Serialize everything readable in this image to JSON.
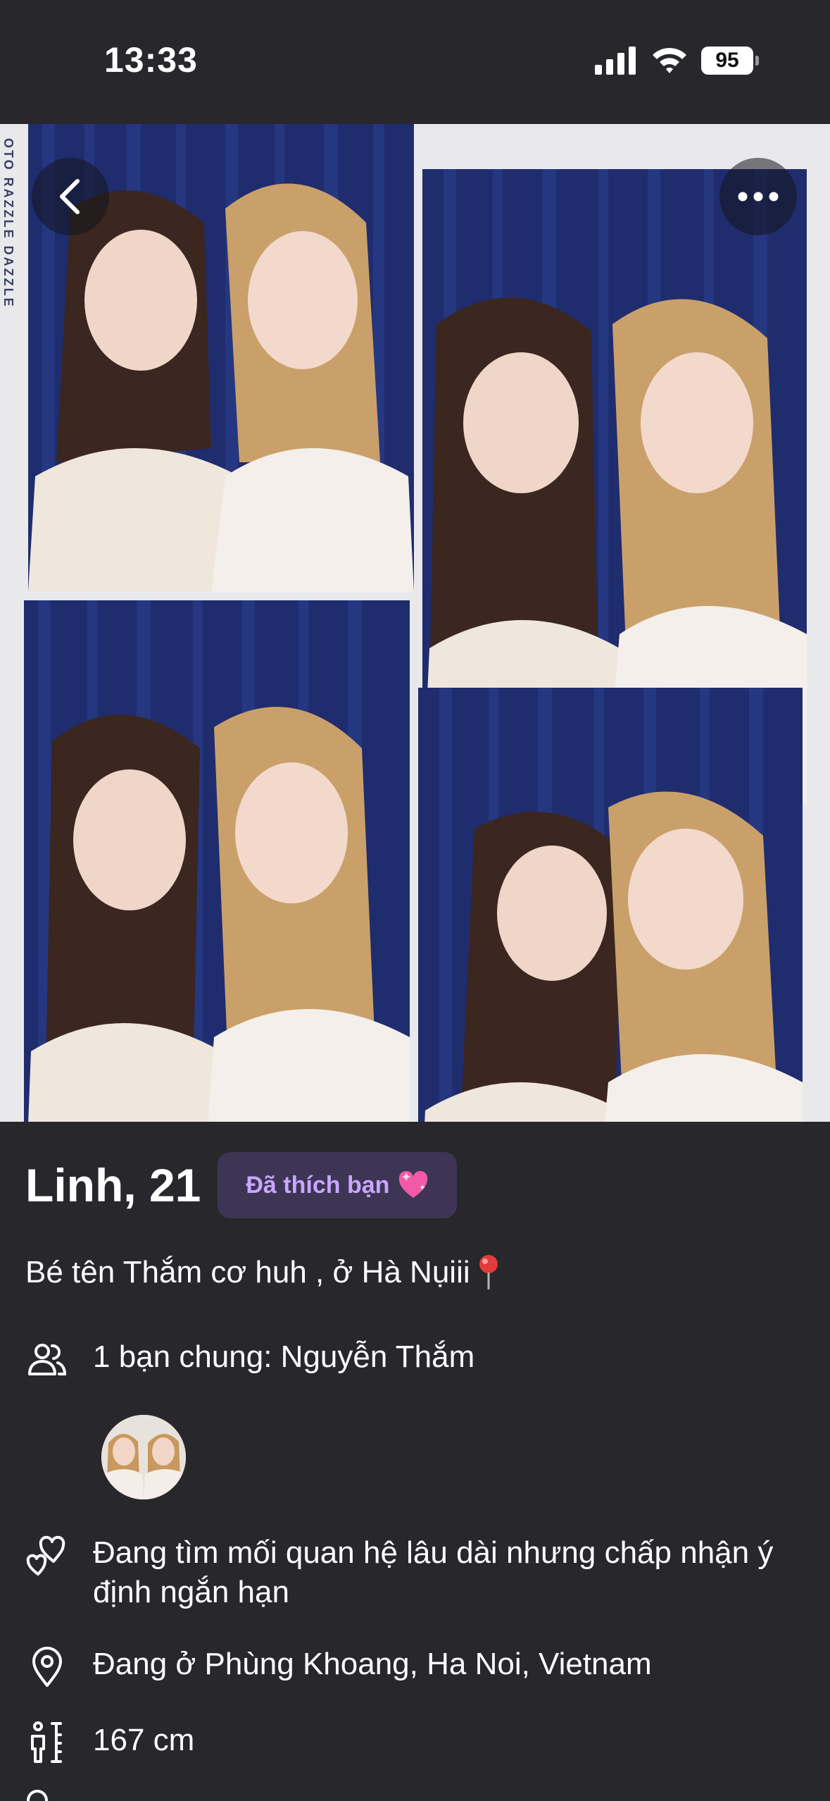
{
  "status_bar": {
    "time": "13:33",
    "battery": "95",
    "icons": [
      "signal-icon",
      "wifi-icon",
      "battery-icon"
    ]
  },
  "photo": {
    "strip_text": "OTO RAZZLE DAZZLE",
    "buttons": {
      "back": "back-icon",
      "more": "more-icon"
    }
  },
  "profile": {
    "name_age": "Linh, 21",
    "liked_badge": "Đã thích bạn",
    "bio": "Bé tên Thắm cơ huh , ở Hà Nụiii",
    "mutual_friends": "1 bạn chung: Nguyễn Thắm",
    "looking_for": "Đang tìm mối quan hệ lâu dài nhưng chấp nhận ý định ngắn hạn",
    "location": "Đang ở Phùng Khoang, Ha Noi, Vietnam",
    "height": "167 cm"
  },
  "colors": {
    "background": "#27272c",
    "badge_bg": "#3d3553",
    "badge_text": "#c9a6ff",
    "curtain": "#1f2d6e"
  }
}
